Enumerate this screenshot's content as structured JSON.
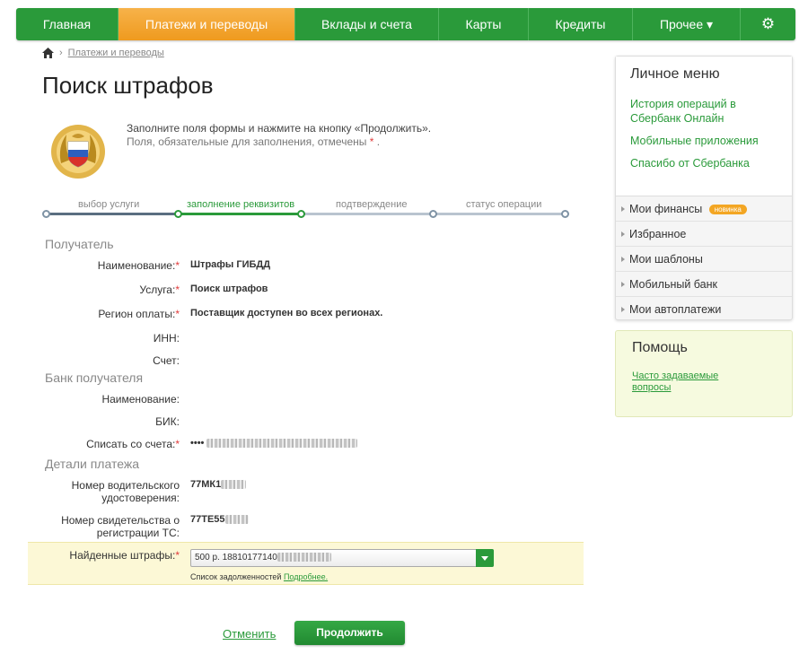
{
  "nav": {
    "items": [
      {
        "label": "Главная",
        "active": false
      },
      {
        "label": "Платежи и переводы",
        "active": true
      },
      {
        "label": "Вклады и счета",
        "active": false
      },
      {
        "label": "Карты",
        "active": false
      },
      {
        "label": "Кредиты",
        "active": false
      },
      {
        "label": "Прочее ▾",
        "active": false
      }
    ],
    "settings_icon": "gear-icon"
  },
  "breadcrumb": {
    "home_icon": "home-icon",
    "separator": "›",
    "link": "Платежи и переводы"
  },
  "page_title": "Поиск штрафов",
  "intro": {
    "line1": "Заполните поля формы и нажмите на кнопку «Продолжить».",
    "line2": "Поля, обязательные для заполнения, отмечены",
    "required_mark": "*",
    "line2_end": "."
  },
  "steps": [
    {
      "label": "выбор услуги",
      "state": "done"
    },
    {
      "label": "заполнение реквизитов",
      "state": "current"
    },
    {
      "label": "подтверждение",
      "state": "pending"
    },
    {
      "label": "статус операции",
      "state": "pending"
    }
  ],
  "sections": {
    "recipient": "Получатель",
    "bank": "Банк получателя",
    "details": "Детали платежа"
  },
  "fields": {
    "name_label": "Наименование:",
    "name_value": "Штрафы ГИБДД",
    "service_label": "Услуга:",
    "service_value": "Поиск штрафов",
    "region_label": "Регион оплаты:",
    "region_value": "Поставщик доступен во всех регионах.",
    "inn_label": "ИНН:",
    "account_label": "Счет:",
    "bank_name_label": "Наименование:",
    "bik_label": "БИК:",
    "debit_label": "Списать со счета:",
    "debit_value": "••••",
    "license_label": "Номер водительского удостоверения:",
    "license_value": "77МК1",
    "vehicle_label": "Номер свидетельства о регистрации ТС:",
    "vehicle_value": "77ТЕ55",
    "fines_label": "Найденные штрафы:",
    "fines_value": "500 р. 18810177140",
    "debts_text": "Список задолженностей",
    "debts_link": "Подробнее."
  },
  "actions": {
    "cancel": "Отменить",
    "continue": "Продолжить"
  },
  "menu": {
    "title": "Личное меню",
    "links": [
      "История операций в Сбербанк Онлайн",
      "Мобильные приложения",
      "Спасибо от Сбербанка"
    ],
    "items": [
      "Мои финансы",
      "Избранное",
      "Мои шаблоны",
      "Мобильный банк",
      "Мои автоплатежи"
    ],
    "badge": "новинка"
  },
  "help": {
    "title": "Помощь",
    "link": "Часто задаваемые вопросы"
  },
  "colors": {
    "brand_green": "#2a9a3a",
    "active_orange": "#ef9a1e",
    "required_red": "#e03a3a"
  }
}
